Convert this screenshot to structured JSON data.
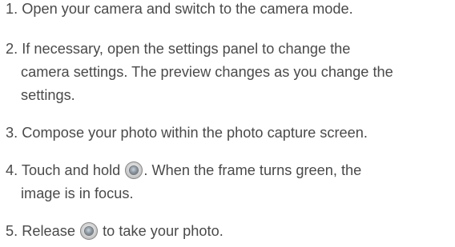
{
  "steps": [
    {
      "number": "1.",
      "lines": [
        "Open your camera and switch to the camera mode."
      ]
    },
    {
      "number": "2.",
      "lines": [
        "If necessary, open the settings panel to change the",
        "camera settings. The preview changes as you change the",
        "settings."
      ]
    },
    {
      "number": "3.",
      "lines": [
        "Compose your photo within the photo capture screen."
      ]
    },
    {
      "number": "4.",
      "line1_before_icon": "Touch and hold",
      "line1_after_icon": ". When the frame turns green, the",
      "line2": "image is in focus."
    },
    {
      "number": "5.",
      "before_icon": "Release",
      "after_icon": "to take your photo."
    }
  ],
  "icons": {
    "shutter": "shutter-button-icon"
  }
}
